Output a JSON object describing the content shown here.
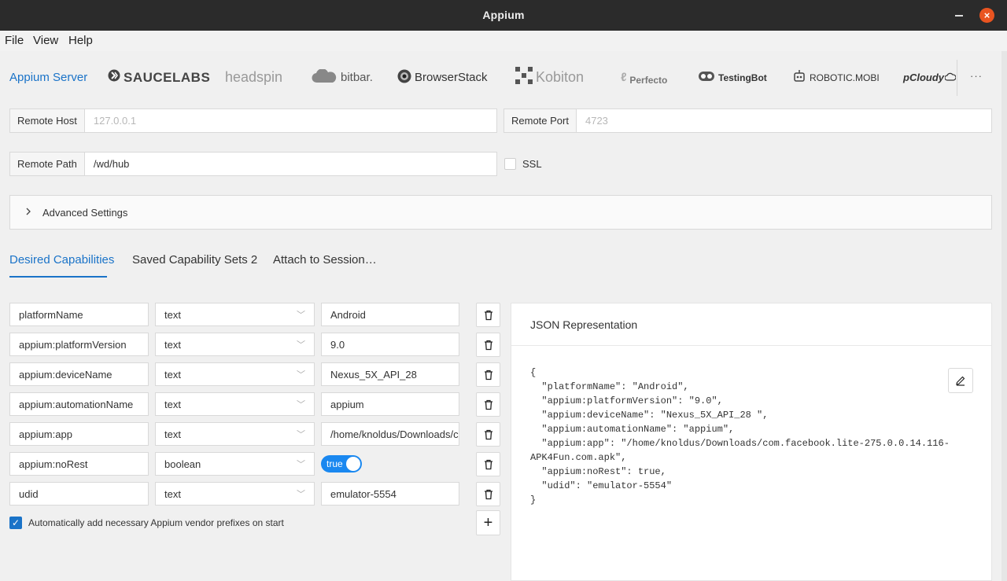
{
  "window": {
    "title": "Appium"
  },
  "menu": [
    "File",
    "View",
    "Help"
  ],
  "providers": {
    "active": "Appium Server",
    "items": [
      "SAUCELABS",
      "headspin",
      "bitbar.",
      "BrowserStack",
      "Kobiton",
      "Perfecto",
      "TestingBot",
      "ROBOTIC.MOBI",
      "pCloudy"
    ],
    "more": "···"
  },
  "server": {
    "host_label": "Remote Host",
    "host_placeholder": "127.0.0.1",
    "port_label": "Remote Port",
    "port_placeholder": "4723",
    "path_label": "Remote Path",
    "path_value": "/wd/hub",
    "ssl_label": "SSL",
    "advanced_label": "Advanced Settings"
  },
  "cap_tabs": [
    "Desired Capabilities",
    "Saved Capability Sets 2",
    "Attach to Session…"
  ],
  "capabilities": [
    {
      "name": "platformName",
      "type": "text",
      "value": "Android"
    },
    {
      "name": "appium:platformVersion",
      "type": "text",
      "value": "9.0"
    },
    {
      "name": "appium:deviceName",
      "type": "text",
      "value": "Nexus_5X_API_28"
    },
    {
      "name": "appium:automationName",
      "type": "text",
      "value": "appium"
    },
    {
      "name": "appium:app",
      "type": "text",
      "value": "/home/knoldus/Downloads/com.facebook.lite-275.0.0.14.116-APK4Fun.com.apk"
    },
    {
      "name": "appium:noRest",
      "type": "boolean",
      "value": "true"
    },
    {
      "name": "udid",
      "type": "text",
      "value": "emulator-5554"
    }
  ],
  "auto_prefix_label": "Automatically add necessary Appium vendor prefixes on start",
  "json_panel": {
    "title": "JSON Representation",
    "body": "{\n  \"platformName\": \"Android\",\n  \"appium:platformVersion\": \"9.0\",\n  \"appium:deviceName\": \"Nexus_5X_API_28 \",\n  \"appium:automationName\": \"appium\",\n  \"appium:app\": \"/home/knoldus/Downloads/com.facebook.lite-275.0.0.14.116-APK4Fun.com.apk\",\n  \"appium:noRest\": true,\n  \"udid\": \"emulator-5554\"\n}"
  },
  "colors": {
    "accent": "#1a73c8",
    "toggle": "#1a88f0",
    "close": "#e95420",
    "titlebar": "#2b2b2b"
  }
}
